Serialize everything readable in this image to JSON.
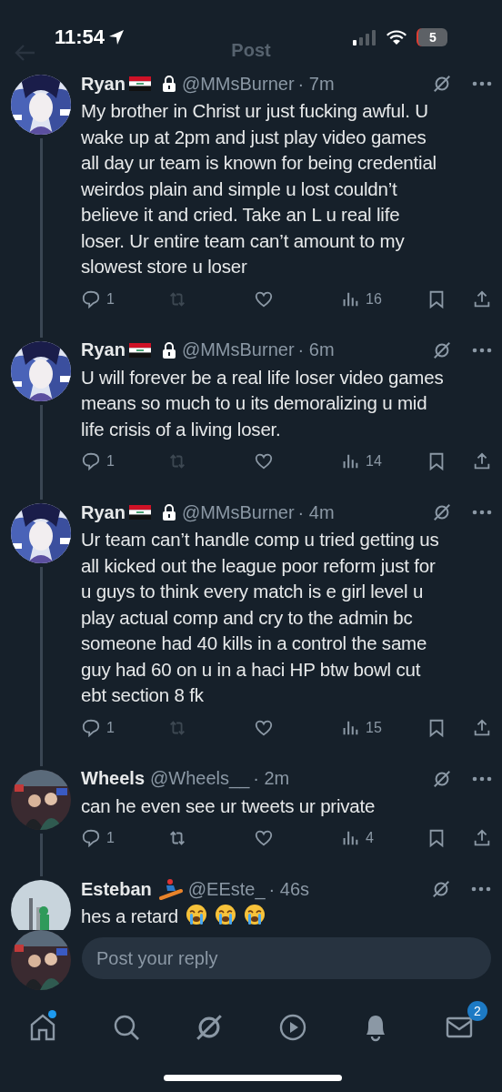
{
  "status_bar": {
    "time": "11:54",
    "battery": "5"
  },
  "header": {
    "title": "Post"
  },
  "tweets": [
    {
      "name": "Ryan",
      "flag": true,
      "protected": true,
      "handle": "@MMsBurner",
      "time": "· 7m",
      "lines": [
        "My brother in Christ ur just fucking awful. U",
        "wake up at 2pm and just play video games",
        "all day ur team is known for being credential",
        "weirdos plain and simple u lost couldn’t",
        "believe it and cried. Take an L u real life",
        "loser. Ur entire team can’t amount to my",
        "slowest store u loser"
      ],
      "replies": "1",
      "retweet_disabled": true,
      "views": "16",
      "thread": true
    },
    {
      "name": "Ryan",
      "flag": true,
      "protected": true,
      "handle": "@MMsBurner",
      "time": "· 6m",
      "lines": [
        "U will forever be a real life loser video games",
        "means so much to u its demoralizing u mid",
        "life crisis of a living loser."
      ],
      "replies": "1",
      "retweet_disabled": true,
      "views": "14",
      "thread": true
    },
    {
      "name": "Ryan",
      "flag": true,
      "protected": true,
      "handle": "@MMsBurner",
      "time": "· 4m",
      "lines": [
        "Ur team can’t handle comp u tried getting us",
        "all kicked out the league poor reform just for",
        "u guys to think every match is e girl level u",
        "play actual comp and cry to the admin bc",
        "someone had 40 kills in a control the same",
        "guy had 60 on u in a haci HP btw bowl cut",
        "ebt section 8 fk"
      ],
      "replies": "1",
      "retweet_disabled": true,
      "views": "15",
      "thread": true
    },
    {
      "name": "Wheels",
      "flag": false,
      "protected": false,
      "handle": "@Wheels__",
      "time": "· 2m",
      "lines": [
        "can he even see ur tweets ur private"
      ],
      "replies": "1",
      "retweet_disabled": false,
      "views": "4",
      "thread": true
    },
    {
      "name": "Esteban",
      "flag": false,
      "badge": {
        "kind": "snowboarder"
      },
      "protected": false,
      "handle": "@EEste_",
      "time": "· 46s",
      "lines": [
        "hes a retard"
      ],
      "emojis": [
        {
          "kind": "crying"
        },
        {
          "kind": "crying"
        },
        {
          "kind": "crying"
        }
      ],
      "thread": false
    }
  ],
  "reply_box": {
    "placeholder": "Post your reply"
  },
  "tab_bar": {
    "items": [
      {
        "kind": "home",
        "dot": true
      },
      {
        "kind": "search"
      },
      {
        "kind": "grok"
      },
      {
        "kind": "play"
      },
      {
        "kind": "bell"
      },
      {
        "kind": "mail",
        "badge": "2"
      }
    ]
  }
}
